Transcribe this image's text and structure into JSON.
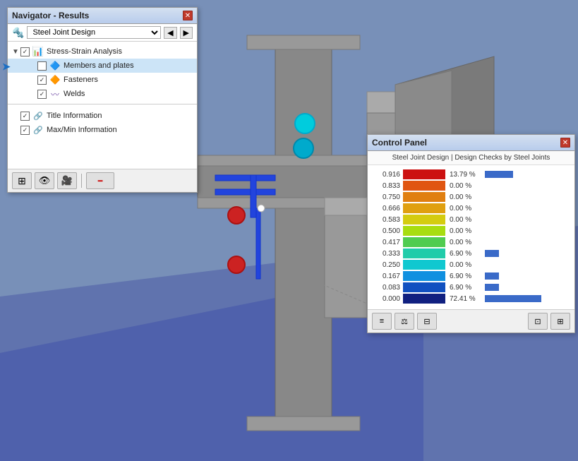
{
  "navigator": {
    "title": "Navigator - Results",
    "dropdown": {
      "selected": "Steel Joint Design",
      "options": [
        "Steel Joint Design"
      ]
    },
    "tree": {
      "root": {
        "label": "Stress-Strain Analysis",
        "expanded": true,
        "checked": true,
        "children": [
          {
            "label": "Members and plates",
            "checked": false,
            "selected": true
          },
          {
            "label": "Fasteners",
            "checked": true
          },
          {
            "label": "Welds",
            "checked": true
          }
        ]
      }
    },
    "bottom_items": [
      {
        "label": "Title Information",
        "checked": true
      },
      {
        "label": "Max/Min Information",
        "checked": true
      }
    ],
    "toolbar": {
      "buttons": [
        "grid-icon",
        "eye-icon",
        "camera-icon",
        "line-icon"
      ]
    }
  },
  "control_panel": {
    "title": "Control Panel",
    "subtitle": "Steel Joint Design | Design Checks by Steel Joints",
    "legend": [
      {
        "value": "0.916",
        "color": "#cc1111",
        "pct": "13.79 %",
        "bar": 40
      },
      {
        "value": "0.833",
        "color": "#e05510",
        "pct": "0.00 %",
        "bar": 0
      },
      {
        "value": "0.750",
        "color": "#e07f10",
        "pct": "0.00 %",
        "bar": 0
      },
      {
        "value": "0.666",
        "color": "#e0a010",
        "pct": "0.00 %",
        "bar": 0
      },
      {
        "value": "0.583",
        "color": "#d4cc10",
        "pct": "0.00 %",
        "bar": 0
      },
      {
        "value": "0.500",
        "color": "#a8dd10",
        "pct": "0.00 %",
        "bar": 0
      },
      {
        "value": "0.417",
        "color": "#50cc50",
        "pct": "0.00 %",
        "bar": 0
      },
      {
        "value": "0.333",
        "color": "#20ccaa",
        "pct": "6.90 %",
        "bar": 20
      },
      {
        "value": "0.250",
        "color": "#10c8d0",
        "pct": "0.00 %",
        "bar": 0
      },
      {
        "value": "0.167",
        "color": "#1090e0",
        "pct": "6.90 %",
        "bar": 20
      },
      {
        "value": "0.083",
        "color": "#1050c0",
        "pct": "6.90 %",
        "bar": 20
      },
      {
        "value": "0.000",
        "color": "#102080",
        "pct": "72.41 %",
        "bar": 80
      }
    ],
    "toolbar_buttons": [
      "table-icon",
      "balance-icon",
      "export-icon",
      "settings1-icon",
      "settings2-icon"
    ]
  },
  "icons": {
    "close": "✕",
    "checked": "✓",
    "expand": "▼",
    "collapse": "▶",
    "arrow_right": "➤",
    "grid": "⊞",
    "eye": "👁",
    "camera": "📷",
    "line": "—",
    "table": "≡",
    "balance": "⚖",
    "export": "⊟",
    "settings1": "⊡",
    "settings2": "⊞"
  }
}
